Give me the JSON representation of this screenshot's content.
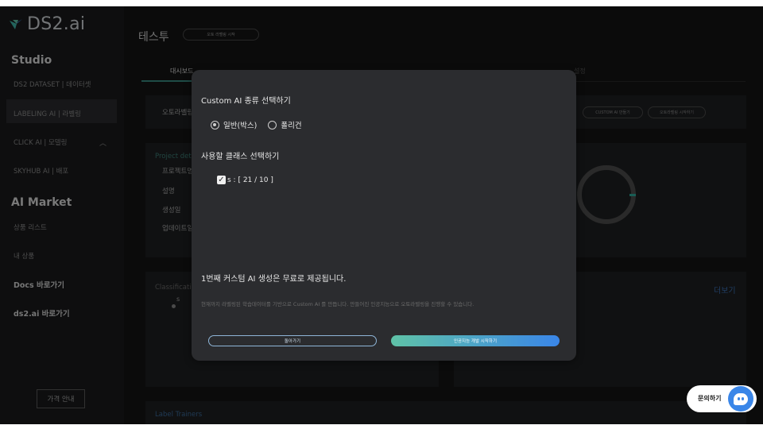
{
  "colors": {
    "accent": "#3a86e8",
    "teal": "#3a8a82",
    "background": "#141414"
  },
  "sidebar": {
    "logo": "DS2.ai",
    "studio_heading": "Studio",
    "items": [
      {
        "label": "DS2 DATASET | 데이터셋"
      },
      {
        "label": "LABELING AI | 라벨링"
      },
      {
        "label": "CLICK AI | 모델링"
      },
      {
        "label": "SKYHUB AI | 배포"
      }
    ],
    "market_heading": "AI Market",
    "market_items": [
      {
        "label": "상품 리스트"
      },
      {
        "label": "내 상품"
      }
    ],
    "docs_link": "Docs 바로가기",
    "ds2_link": "ds2.ai 바로가기",
    "price_button": "가격 안내"
  },
  "main": {
    "title": "테스투",
    "auto_label_button": "오토 라벨링 시작",
    "tabs": [
      {
        "label": "대시보드"
      },
      {
        "label": ""
      },
      {
        "label": ""
      },
      {
        "label": ""
      },
      {
        "label": ""
      },
      {
        "label": "설정"
      }
    ],
    "autolabel_card": {
      "label": "오토라벨링",
      "custom_ai_button": "CUSTOM AI 만들기",
      "autolabel_start_button": "오토라벨링 시작하기"
    },
    "project_card": {
      "title": "Project det",
      "rows": [
        "프로젝트명",
        "설명",
        "생성일",
        "업데이트일"
      ]
    },
    "classification_card": {
      "title": "Classificati",
      "item": "s",
      "more_link": "더보기"
    },
    "trainers_label": "Label Trainers"
  },
  "modal": {
    "title": "Custom AI 종류 선택하기",
    "type_options": [
      {
        "label": "일반(박스)",
        "checked": true
      },
      {
        "label": "폴리건",
        "checked": false
      }
    ],
    "class_heading": "사용할 클래스 선택하기",
    "class_item": "s : [ 21 / 10 ]",
    "free_notice": "1번째 커스텀 AI 생성은 무료로 제공됩니다.",
    "description": "현재까지 라벨링된 학습데이터를 기반으로 Custom AI 를 만듭니다. 만들어진 인공지능으로 오토라벨링을 진행할 수 있습니다.",
    "back_button": "돌아가기",
    "start_button": "인공지능 개발 시작하기"
  },
  "chat": {
    "label": "문의하기"
  }
}
